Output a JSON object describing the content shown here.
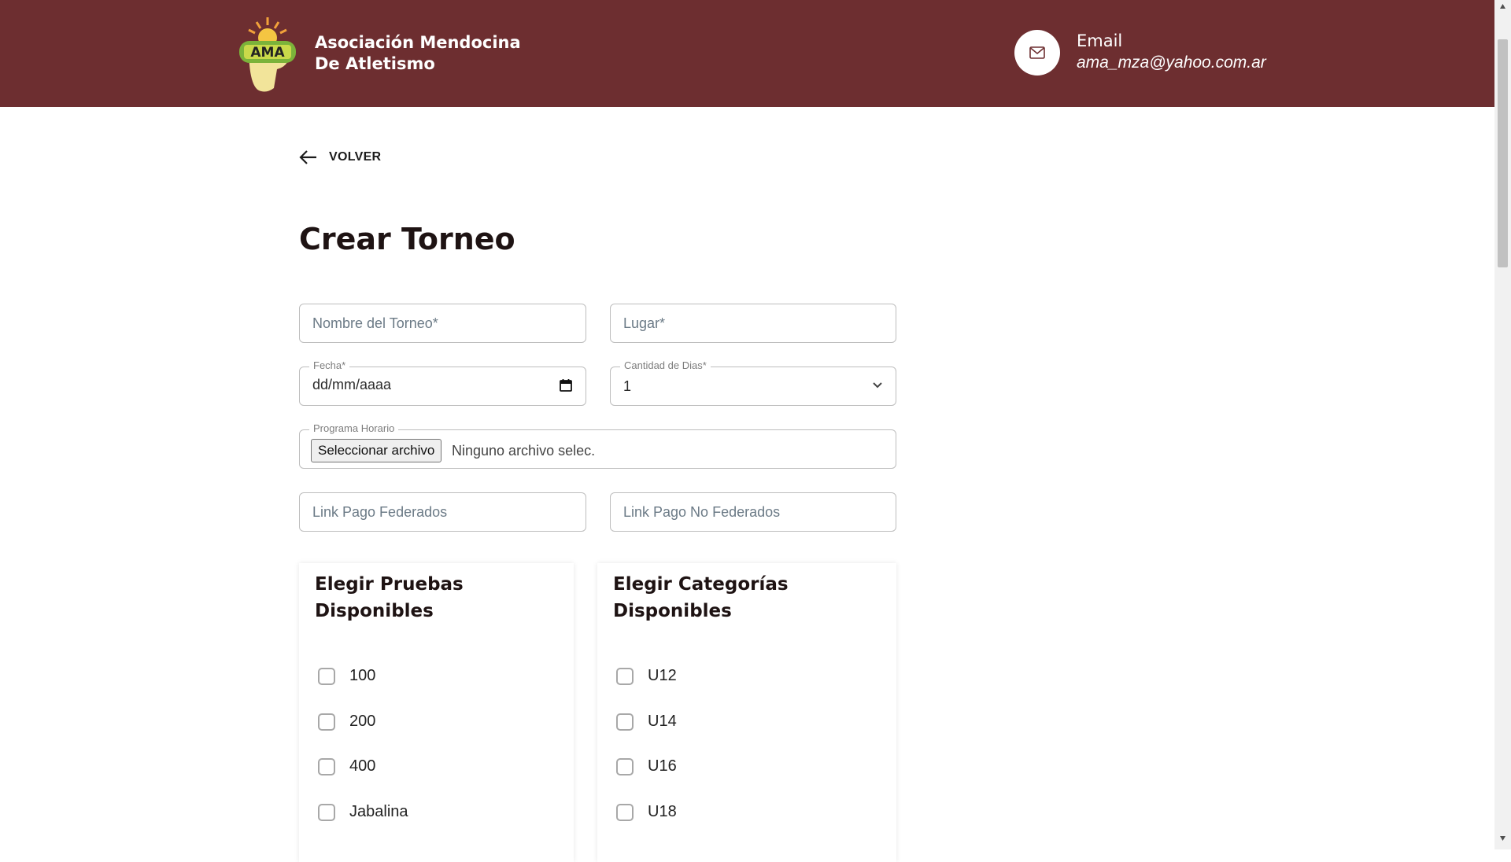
{
  "header": {
    "logo_text": "AMA",
    "org_name_line1": "Asociación Mendocina",
    "org_name_line2": "De Atletismo",
    "contact_label": "Email",
    "contact_value": "ama_mza@yahoo.com.ar",
    "icons": {
      "contact": "mail-icon"
    },
    "colors": {
      "bar": "#6d2e30"
    }
  },
  "nav": {
    "back_label": "VOLVER",
    "back_icon": "arrow-left-icon"
  },
  "page": {
    "title": "Crear Torneo"
  },
  "form": {
    "nombre_placeholder": "Nombre del Torneo*",
    "lugar_placeholder": "Lugar*",
    "fecha_label": "Fecha*",
    "fecha_value": "dd/mm/aaaa",
    "dias_label": "Cantidad de Dias*",
    "dias_value": "1",
    "programa_label": "Programa Horario",
    "file_button": "Seleccionar archivo",
    "file_status": "Ninguno archivo selec.",
    "link_fed_placeholder": "Link Pago Federados",
    "link_nofed_placeholder": "Link Pago No Federados"
  },
  "pruebas": {
    "title": "Elegir Pruebas Disponibles",
    "items": [
      {
        "label": "100",
        "checked": false
      },
      {
        "label": "200",
        "checked": false
      },
      {
        "label": "400",
        "checked": false
      },
      {
        "label": "Jabalina",
        "checked": false
      }
    ]
  },
  "categorias": {
    "title": "Elegir Categorías Disponibles",
    "items": [
      {
        "label": "U12",
        "checked": false
      },
      {
        "label": "U14",
        "checked": false
      },
      {
        "label": "U16",
        "checked": false
      },
      {
        "label": "U18",
        "checked": false
      }
    ]
  }
}
